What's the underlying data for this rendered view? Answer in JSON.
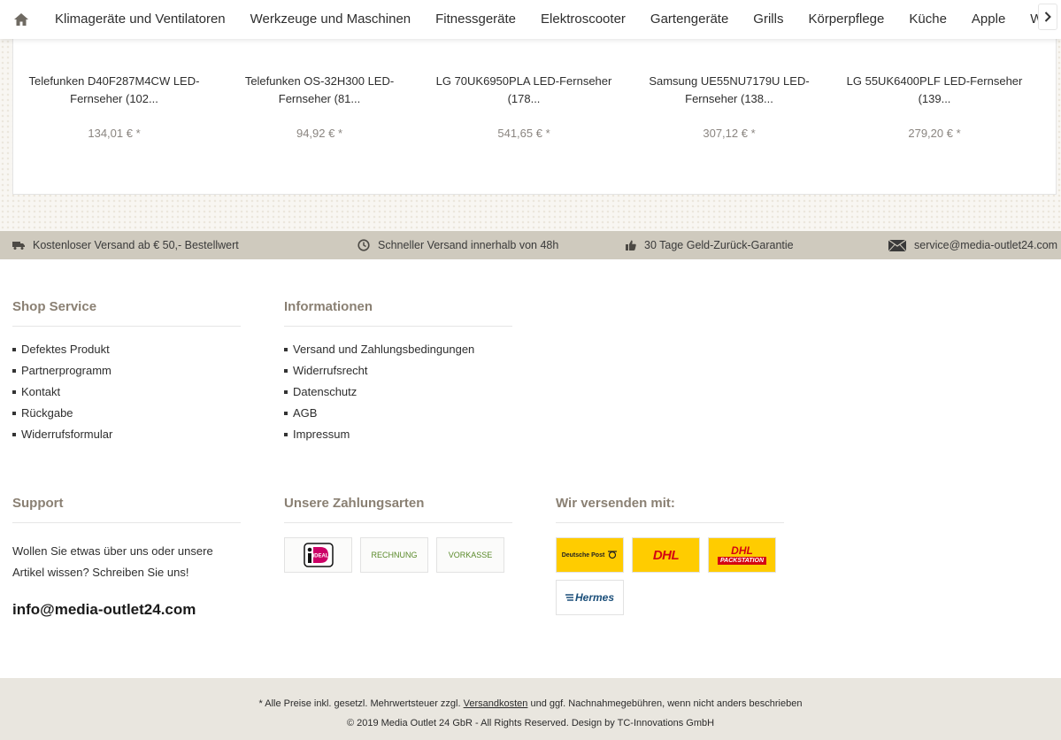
{
  "nav": {
    "items": [
      "Klimageräte und Ventilatoren",
      "Werkzeuge und Maschinen",
      "Fitnessgeräte",
      "Elektroscooter",
      "Gartengeräte",
      "Grills",
      "Körperpflege",
      "Küche",
      "Apple",
      "W"
    ]
  },
  "products": [
    {
      "name": "Telefunken D40F287M4CW LED-Fernseher (102...",
      "price": "134,01 € *"
    },
    {
      "name": "Telefunken OS-32H300 LED-Fernseher (81...",
      "price": "94,92 € *"
    },
    {
      "name": "LG 70UK6950PLA LED-Fernseher (178...",
      "price": "541,65 € *"
    },
    {
      "name": "Samsung UE55NU7179U LED-Fernseher (138...",
      "price": "307,12 € *"
    },
    {
      "name": "LG 55UK6400PLF LED-Fernseher (139...",
      "price": "279,20 € *"
    }
  ],
  "service_bar": {
    "shipping": "Kostenloser Versand ab € 50,- Bestellwert",
    "fast": "Schneller Versand innerhalb von 48h",
    "guarantee": "30 Tage Geld-Zurück-Garantie",
    "email": "service@media-outlet24.com"
  },
  "shop_service": {
    "title": "Shop Service",
    "items": [
      "Defektes Produkt",
      "Partnerprogramm",
      "Kontakt",
      "Rückgabe",
      "Widerrufsformular"
    ]
  },
  "informationen": {
    "title": "Informationen",
    "items": [
      "Versand und Zahlungsbedingungen",
      "Widerrufsrecht",
      "Datenschutz",
      "AGB",
      "Impressum"
    ]
  },
  "support": {
    "title": "Support",
    "text": "Wollen Sie etwas über uns oder unsere Artikel wissen? Schreiben Sie uns!",
    "email": "info@media-outlet24.com"
  },
  "payment": {
    "title": "Unsere Zahlungsarten",
    "methods": [
      "iDEAL",
      "RECHNUNG",
      "VORKASSE"
    ]
  },
  "shipping": {
    "title": "Wir versenden mit:",
    "carriers": [
      "Deutsche Post",
      "DHL",
      "DHL",
      "PACKSTATION",
      "Hermes"
    ]
  },
  "footer": {
    "line1_pre": "* Alle Preise inkl. gesetzl. Mehrwertsteuer zzgl.",
    "line1_link": "Versandkosten",
    "line1_post": "und ggf. Nachnahmegebühren, wenn nicht anders beschrieben",
    "line2": "© 2019 Media Outlet 24 GbR - All Rights Reserved. Design by TC-Innovations GmbH"
  },
  "colors": {
    "service_bar_bg": "#cfcabe",
    "heading": "#8a8073",
    "footer_bg": "#e9e6df",
    "dhl_yellow": "#ffcc00",
    "dhl_red": "#d40511"
  }
}
